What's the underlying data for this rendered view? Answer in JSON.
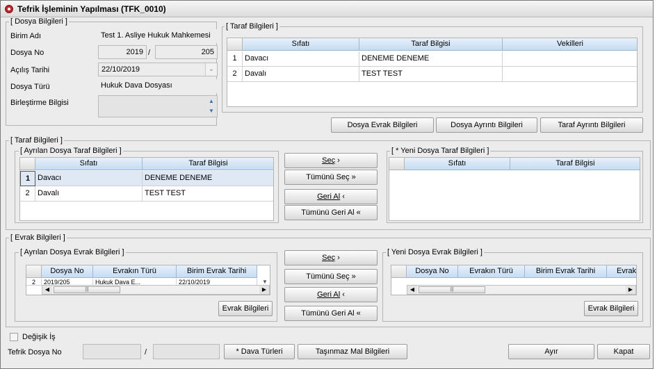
{
  "window": {
    "title": "Tefrik İşleminin Yapılması (TFK_0010)"
  },
  "dosya": {
    "group_label": "[ Dosya Bilgileri ]",
    "birim_label": "Birim Adı",
    "birim_value": "Test 1. Asliye Hukuk Mahkemesi",
    "dosyano_label": "Dosya No",
    "dosyano_year": "2019",
    "dosyano_sep": "/",
    "dosyano_num": "205",
    "acilis_label": "Açılış Tarihi",
    "acilis_value": "22/10/2019",
    "tur_label": "Dosya Türü",
    "tur_value": "Hukuk Dava Dosyası",
    "birlestirme_label": "Birleştirme Bilgisi"
  },
  "taraf_top": {
    "group_label": "[ Taraf Bilgileri ]",
    "headers": [
      "Sıfatı",
      "Taraf Bilgisi",
      "Vekilleri"
    ],
    "rows": [
      {
        "n": "1",
        "sifat": "Davacı",
        "taraf": "DENEME DENEME",
        "vekil": ""
      },
      {
        "n": "2",
        "sifat": "Davalı",
        "taraf": "TEST TEST",
        "vekil": ""
      }
    ]
  },
  "top_buttons": {
    "evrak": "Dosya Evrak Bilgileri",
    "ayrinti": "Dosya Ayrıntı Bilgileri",
    "taraf_ayrinti": "Taraf Ayrıntı Bilgileri"
  },
  "taraf_section": {
    "group_label": "[ Taraf Bilgileri ]",
    "ayrilan_label": "[ Ayrılan Dosya Taraf Bilgileri ]",
    "ayrilan_headers": [
      "Sıfatı",
      "Taraf Bilgisi"
    ],
    "ayrilan_rows": [
      {
        "n": "1",
        "sifat": "Davacı",
        "taraf": "DENEME DENEME"
      },
      {
        "n": "2",
        "sifat": "Davalı",
        "taraf": "TEST TEST"
      }
    ],
    "yeni_label": "[ * Yeni Dosya Taraf Bilgileri ]",
    "yeni_headers": [
      "Sıfatı",
      "Taraf Bilgisi"
    ]
  },
  "move_buttons": {
    "sec": "Seç",
    "tumunu_sec": "Tümünü Seç",
    "geri_al": "Geri Al",
    "tumunu_geri_al": "Tümünü Geri Al"
  },
  "evrak_section": {
    "group_label": "[ Evrak Bilgileri ]",
    "ayrilan_label": "[ Ayrılan Dosya Evrak  Bilgileri ]",
    "ayrilan_headers": [
      "Dosya No",
      "Evrakın Türü",
      "Birim Evrak Tarihi"
    ],
    "ayrilan_partial_row": {
      "n": "2",
      "dosya": "2019/205",
      "tur": "Hukuk Dava E...",
      "tarih": "22/10/2019"
    },
    "yeni_label": "[ Yeni Dosya Evrak Bilgileri ]",
    "yeni_headers": [
      "Dosya No",
      "Evrakın Türü",
      "Birim Evrak Tarihi",
      "Evrak"
    ],
    "evrak_button": "Evrak Bilgileri"
  },
  "bottom": {
    "degisik_is_label": "Değişik İş",
    "tefrik_label": "Tefrik Dosya No",
    "tefrik_sep": "/",
    "dava_turleri": "* Dava Türleri",
    "tasinmaz": "Taşınmaz Mal Bilgileri",
    "ayir": "Ayır",
    "kapat": "Kapat"
  }
}
